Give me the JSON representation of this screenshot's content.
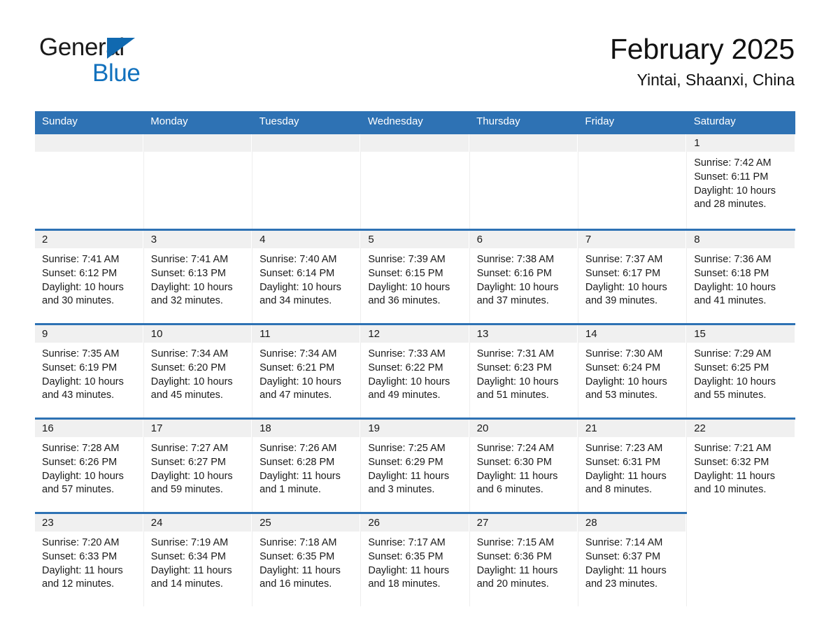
{
  "brand": {
    "name_part1": "General",
    "name_part2": "Blue",
    "triangle_icon": "triangle-icon",
    "accent_dark": "#1069b0",
    "accent_light": "#1271bd"
  },
  "header": {
    "title": "February 2025",
    "subtitle": "Yintai, Shaanxi, China"
  },
  "theme": {
    "header_blue": "#2e72b4",
    "row_divider_blue": "#2e72b4",
    "daynum_band": "#f0f0f0",
    "page_background": "#ffffff",
    "text": "#1a1a1a"
  },
  "weekday_headers": [
    "Sunday",
    "Monday",
    "Tuesday",
    "Wednesday",
    "Thursday",
    "Friday",
    "Saturday"
  ],
  "weeks": [
    [
      {
        "day": "",
        "empty": true
      },
      {
        "day": "",
        "empty": true
      },
      {
        "day": "",
        "empty": true
      },
      {
        "day": "",
        "empty": true
      },
      {
        "day": "",
        "empty": true
      },
      {
        "day": "",
        "empty": true
      },
      {
        "day": "1",
        "sunrise": "Sunrise: 7:42 AM",
        "sunset": "Sunset: 6:11 PM",
        "daylight": "Daylight: 10 hours and 28 minutes."
      }
    ],
    [
      {
        "day": "2",
        "sunrise": "Sunrise: 7:41 AM",
        "sunset": "Sunset: 6:12 PM",
        "daylight": "Daylight: 10 hours and 30 minutes."
      },
      {
        "day": "3",
        "sunrise": "Sunrise: 7:41 AM",
        "sunset": "Sunset: 6:13 PM",
        "daylight": "Daylight: 10 hours and 32 minutes."
      },
      {
        "day": "4",
        "sunrise": "Sunrise: 7:40 AM",
        "sunset": "Sunset: 6:14 PM",
        "daylight": "Daylight: 10 hours and 34 minutes."
      },
      {
        "day": "5",
        "sunrise": "Sunrise: 7:39 AM",
        "sunset": "Sunset: 6:15 PM",
        "daylight": "Daylight: 10 hours and 36 minutes."
      },
      {
        "day": "6",
        "sunrise": "Sunrise: 7:38 AM",
        "sunset": "Sunset: 6:16 PM",
        "daylight": "Daylight: 10 hours and 37 minutes."
      },
      {
        "day": "7",
        "sunrise": "Sunrise: 7:37 AM",
        "sunset": "Sunset: 6:17 PM",
        "daylight": "Daylight: 10 hours and 39 minutes."
      },
      {
        "day": "8",
        "sunrise": "Sunrise: 7:36 AM",
        "sunset": "Sunset: 6:18 PM",
        "daylight": "Daylight: 10 hours and 41 minutes."
      }
    ],
    [
      {
        "day": "9",
        "sunrise": "Sunrise: 7:35 AM",
        "sunset": "Sunset: 6:19 PM",
        "daylight": "Daylight: 10 hours and 43 minutes."
      },
      {
        "day": "10",
        "sunrise": "Sunrise: 7:34 AM",
        "sunset": "Sunset: 6:20 PM",
        "daylight": "Daylight: 10 hours and 45 minutes."
      },
      {
        "day": "11",
        "sunrise": "Sunrise: 7:34 AM",
        "sunset": "Sunset: 6:21 PM",
        "daylight": "Daylight: 10 hours and 47 minutes."
      },
      {
        "day": "12",
        "sunrise": "Sunrise: 7:33 AM",
        "sunset": "Sunset: 6:22 PM",
        "daylight": "Daylight: 10 hours and 49 minutes."
      },
      {
        "day": "13",
        "sunrise": "Sunrise: 7:31 AM",
        "sunset": "Sunset: 6:23 PM",
        "daylight": "Daylight: 10 hours and 51 minutes."
      },
      {
        "day": "14",
        "sunrise": "Sunrise: 7:30 AM",
        "sunset": "Sunset: 6:24 PM",
        "daylight": "Daylight: 10 hours and 53 minutes."
      },
      {
        "day": "15",
        "sunrise": "Sunrise: 7:29 AM",
        "sunset": "Sunset: 6:25 PM",
        "daylight": "Daylight: 10 hours and 55 minutes."
      }
    ],
    [
      {
        "day": "16",
        "sunrise": "Sunrise: 7:28 AM",
        "sunset": "Sunset: 6:26 PM",
        "daylight": "Daylight: 10 hours and 57 minutes."
      },
      {
        "day": "17",
        "sunrise": "Sunrise: 7:27 AM",
        "sunset": "Sunset: 6:27 PM",
        "daylight": "Daylight: 10 hours and 59 minutes."
      },
      {
        "day": "18",
        "sunrise": "Sunrise: 7:26 AM",
        "sunset": "Sunset: 6:28 PM",
        "daylight": "Daylight: 11 hours and 1 minute."
      },
      {
        "day": "19",
        "sunrise": "Sunrise: 7:25 AM",
        "sunset": "Sunset: 6:29 PM",
        "daylight": "Daylight: 11 hours and 3 minutes."
      },
      {
        "day": "20",
        "sunrise": "Sunrise: 7:24 AM",
        "sunset": "Sunset: 6:30 PM",
        "daylight": "Daylight: 11 hours and 6 minutes."
      },
      {
        "day": "21",
        "sunrise": "Sunrise: 7:23 AM",
        "sunset": "Sunset: 6:31 PM",
        "daylight": "Daylight: 11 hours and 8 minutes."
      },
      {
        "day": "22",
        "sunrise": "Sunrise: 7:21 AM",
        "sunset": "Sunset: 6:32 PM",
        "daylight": "Daylight: 11 hours and 10 minutes."
      }
    ],
    [
      {
        "day": "23",
        "sunrise": "Sunrise: 7:20 AM",
        "sunset": "Sunset: 6:33 PM",
        "daylight": "Daylight: 11 hours and 12 minutes."
      },
      {
        "day": "24",
        "sunrise": "Sunrise: 7:19 AM",
        "sunset": "Sunset: 6:34 PM",
        "daylight": "Daylight: 11 hours and 14 minutes."
      },
      {
        "day": "25",
        "sunrise": "Sunrise: 7:18 AM",
        "sunset": "Sunset: 6:35 PM",
        "daylight": "Daylight: 11 hours and 16 minutes."
      },
      {
        "day": "26",
        "sunrise": "Sunrise: 7:17 AM",
        "sunset": "Sunset: 6:35 PM",
        "daylight": "Daylight: 11 hours and 18 minutes."
      },
      {
        "day": "27",
        "sunrise": "Sunrise: 7:15 AM",
        "sunset": "Sunset: 6:36 PM",
        "daylight": "Daylight: 11 hours and 20 minutes."
      },
      {
        "day": "28",
        "sunrise": "Sunrise: 7:14 AM",
        "sunset": "Sunset: 6:37 PM",
        "daylight": "Daylight: 11 hours and 23 minutes."
      },
      {
        "day": "",
        "empty": true
      }
    ]
  ]
}
